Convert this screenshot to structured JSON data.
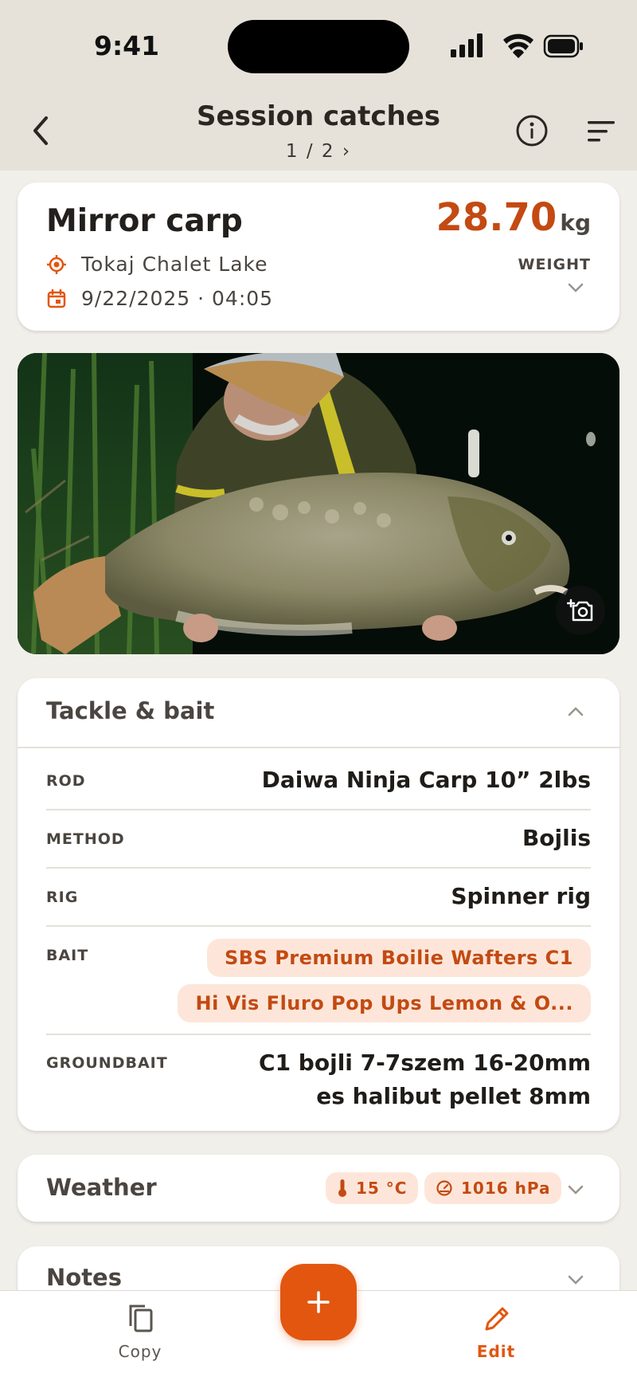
{
  "status_bar": {
    "time": "9:41",
    "icons": [
      "signal-icon",
      "wifi-icon",
      "battery-icon"
    ]
  },
  "nav": {
    "title": "Session catches",
    "pager": "1 / 2 ›",
    "back_icon": "chevron-left-icon",
    "info_icon": "info-icon",
    "sort_icon": "sort-icon"
  },
  "catch": {
    "species": "Mirror carp",
    "location": "Tokaj Chalet Lake",
    "datetime": "9/22/2025 · 04:05",
    "weight_value": "28.70",
    "weight_unit": "kg",
    "weight_label": "WEIGHT"
  },
  "photo": {
    "add_photo_icon": "camera-add-icon"
  },
  "tackle": {
    "title": "Tackle & bait",
    "rows": [
      {
        "label": "ROD",
        "value": "Daiwa Ninja Carp 10” 2lbs"
      },
      {
        "label": "METHOD",
        "value": "Bojlis"
      },
      {
        "label": "RIG",
        "value": "Spinner rig"
      }
    ],
    "bait_label": "BAIT",
    "baits": [
      "SBS Premium Boilie Wafters C1",
      "Hi Vis Fluro Pop Ups Lemon & O..."
    ],
    "groundbait_label": "GROUNDBAIT",
    "groundbait_value": "C1 bojli 7-7szem 16-20mm es halibut pellet 8mm"
  },
  "weather": {
    "title": "Weather",
    "temperature": "15 °C",
    "pressure": "1016 hPa"
  },
  "notes": {
    "title": "Notes"
  },
  "bottom_bar": {
    "copy_label": "Copy",
    "edit_label": "Edit",
    "fab_icon": "plus-icon"
  },
  "colors": {
    "accent": "#e2560f",
    "accent_text": "#c34a12",
    "chip_bg": "#fde6d9",
    "header_bg": "#e6e2d9",
    "page_bg": "#f1efea"
  }
}
